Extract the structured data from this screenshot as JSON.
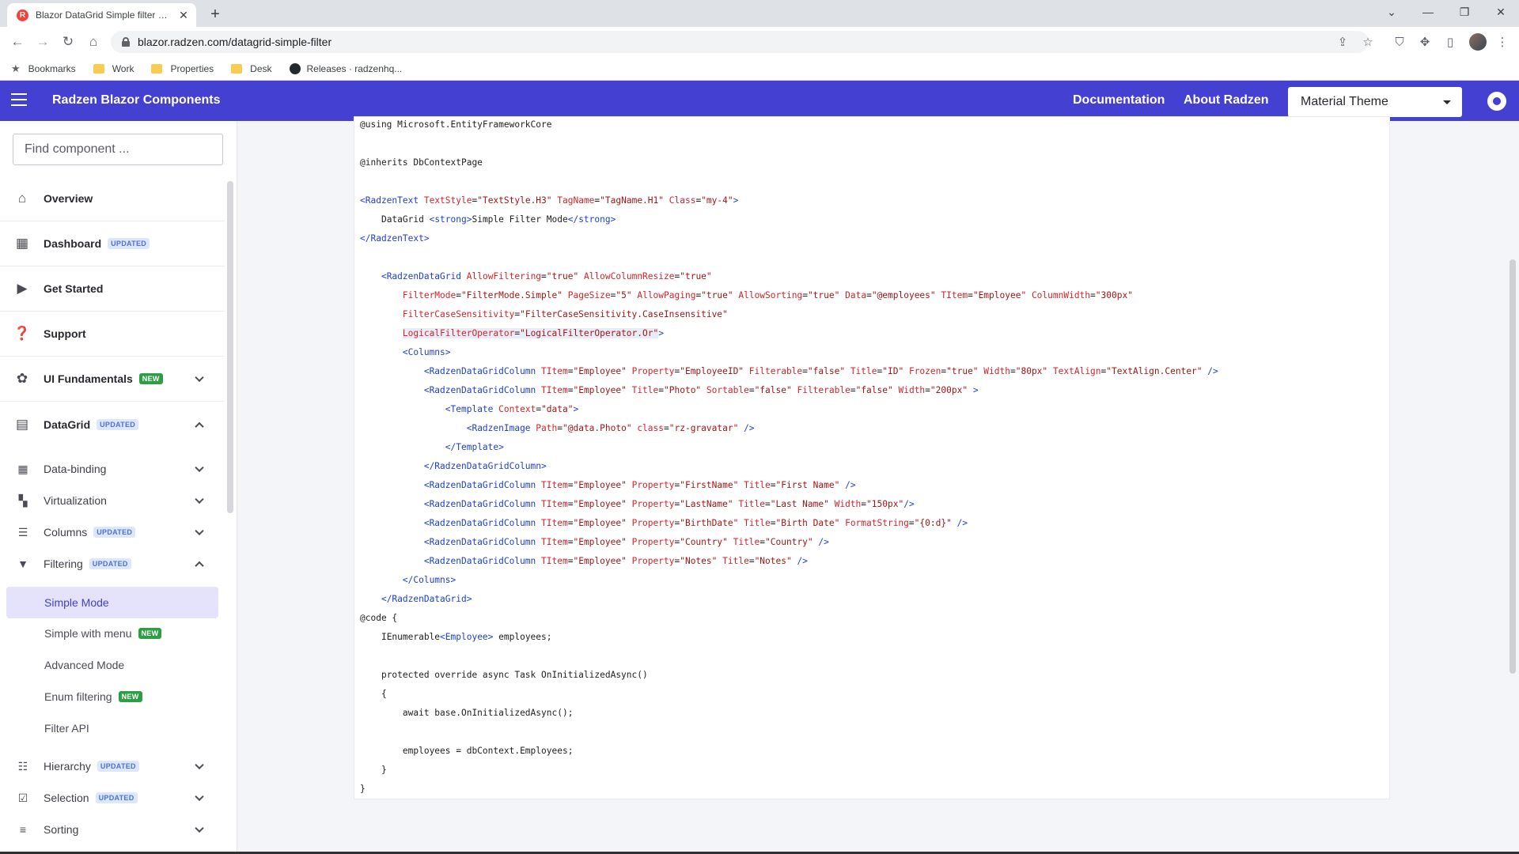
{
  "browser": {
    "tab_title": "Blazor DataGrid Simple filter mode",
    "favicon_letter": "R",
    "url": "blazor.radzen.com/datagrid-simple-filter",
    "bookmarks": [
      "Bookmarks",
      "Work",
      "Properties",
      "Desk",
      "Releases · radzenhq..."
    ]
  },
  "header": {
    "brand": "Radzen Blazor Components",
    "links": [
      "Documentation",
      "About Radzen"
    ],
    "theme": "Material Theme",
    "accent": "#4340d2"
  },
  "sidebar": {
    "search_placeholder": "Find component ...",
    "top_items": [
      {
        "label": "Overview",
        "icon": "home-icon"
      },
      {
        "label": "Dashboard",
        "badge": "UPDATED",
        "icon": "dashboard-icon"
      },
      {
        "label": "Get Started",
        "icon": "play-icon"
      },
      {
        "label": "Support",
        "icon": "help-icon"
      },
      {
        "label": "UI Fundamentals",
        "badge": "NEW",
        "icon": "palette-icon"
      },
      {
        "label": "DataGrid",
        "badge": "UPDATED",
        "icon": "grid-icon"
      }
    ],
    "sub_items": [
      {
        "label": "Data-binding",
        "icon": "table-icon"
      },
      {
        "label": "Virtualization",
        "icon": "dashboard-icon"
      },
      {
        "label": "Columns",
        "badge": "UPDATED",
        "icon": "columns-icon"
      },
      {
        "label": "Filtering",
        "badge": "UPDATED",
        "icon": "filter-icon"
      }
    ],
    "filter_children": [
      {
        "label": "Simple Mode",
        "active": true
      },
      {
        "label": "Simple with menu",
        "badge": "NEW"
      },
      {
        "label": "Advanced Mode"
      },
      {
        "label": "Enum filtering",
        "badge": "NEW"
      },
      {
        "label": "Filter API"
      }
    ],
    "more_items": [
      {
        "label": "Hierarchy",
        "badge": "UPDATED",
        "icon": "hierarchy-icon"
      },
      {
        "label": "Selection",
        "badge": "UPDATED",
        "icon": "checklist-icon"
      },
      {
        "label": "Sorting",
        "icon": "sort-icon"
      }
    ]
  },
  "code": {
    "l0": "@using Microsoft.EntityFrameworkCore",
    "l2": "@inherits DbContextPage",
    "rt_open": "<RadzenText",
    "rt_a1": "TextStyle",
    "rt_v1": "\"TextStyle.H3\"",
    "rt_a2": "TagName",
    "rt_v2": "\"TagName.H1\"",
    "rt_a3": "Class",
    "rt_v3": "\"my-4\"",
    "rt_text": "DataGrid ",
    "strong_o": "<strong>",
    "strong_t": "Simple Filter Mode",
    "strong_c": "</strong>",
    "rt_close": "</RadzenText>",
    "dg_open": "<RadzenDataGrid",
    "dg_a1": "AllowFiltering",
    "dg_v1": "\"true\"",
    "dg_a2": "AllowColumnResize",
    "dg_v2": "\"true\"",
    "dg_a3": "FilterMode",
    "dg_v3": "\"FilterMode.Simple\"",
    "dg_a4": "PageSize",
    "dg_v4": "\"5\"",
    "dg_a5": "AllowPaging",
    "dg_v5": "\"true\"",
    "dg_a6": "AllowSorting",
    "dg_v6": "\"true\"",
    "dg_a7": "Data",
    "dg_v7": "\"@employees\"",
    "dg_a8": "TItem",
    "dg_v8": "\"Employee\"",
    "dg_a9": "ColumnWidth",
    "dg_v9": "\"300px\"",
    "dg_a10": "FilterCaseSensitivity",
    "dg_v10": "\"FilterCaseSensitivity.CaseInsensitive\"",
    "dg_a11": "LogicalFilterOperator",
    "dg_v11": "\"LogicalFilterOperator.Or\"",
    "cols_open": "<Columns>",
    "cols_close": "</Columns>",
    "col": "<RadzenDataGridColumn",
    "col_close": "</RadzenDataGridColumn>",
    "a_titem": "TItem",
    "v_emp": "\"Employee\"",
    "a_prop": "Property",
    "a_title": "Title",
    "a_filt": "Filterable",
    "a_sort": "Sortable",
    "a_frozen": "Frozen",
    "a_width": "Width",
    "a_align": "TextAlign",
    "a_fmt": "FormatString",
    "v_empid": "\"EmployeeID\"",
    "v_id": "\"ID\"",
    "v_false": "\"false\"",
    "v_true": "\"true\"",
    "v_80": "\"80px\"",
    "v_center": "\"TextAlign.Center\"",
    "v_photo": "\"Photo\"",
    "v_200": "\"200px\"",
    "tpl_open": "<Template",
    "a_ctx": "Context",
    "v_data": "\"data\"",
    "tpl_close": "</Template>",
    "img_open": "<RadzenImage",
    "a_path": "Path",
    "v_path": "\"@data.Photo\"",
    "a_class": "class",
    "v_grav": "\"rz-gravatar\"",
    "v_fn": "\"FirstName\"",
    "v_fn_t": "\"First Name\"",
    "v_ln": "\"LastName\"",
    "v_ln_t": "\"Last Name\"",
    "v_150": "\"150px\"",
    "v_bd": "\"BirthDate\"",
    "v_bd_t": "\"Birth Date\"",
    "v_bd_f": "\"{0:d}\"",
    "v_country": "\"Country\"",
    "v_notes": "\"Notes\"",
    "dg_close": "</RadzenDataGrid>",
    "code_kw": "@code {",
    "ienum": "IEnumerable",
    "emp_t": "<Employee>",
    "employees": " employees;",
    "method": "protected override async Task OnInitializedAsync()",
    "brace_o": "{",
    "await": "await base.OnInitializedAsync();",
    "assign": "employees = dbContext.Employees;",
    "brace_c": "}"
  }
}
